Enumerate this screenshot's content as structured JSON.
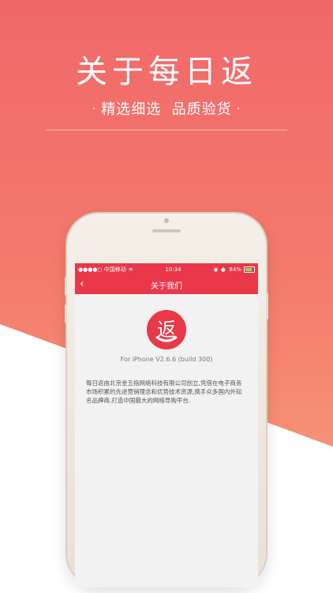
{
  "hero": {
    "title": "关于每日返",
    "subtitle_left": "精选细选",
    "subtitle_right": "品质验货",
    "dot": "·"
  },
  "status_bar": {
    "carrier": "●●●●○ 中国移动",
    "wifi": "≋",
    "time": "10:34",
    "icons": "◉ ⏰",
    "battery": "84%"
  },
  "nav": {
    "back_icon": "‹",
    "title": "关于我们"
  },
  "about": {
    "logo_char": "返",
    "version": "For iPhone V2.6.6 (build 300)",
    "description": "每日返由北京金五指网络科技有限公司创立,凭借在电子商务市场积累的先进营销理念和优势技术资源,携手众多国内外知名品牌商,打造中国最大的网络导购平台."
  },
  "colors": {
    "accent": "#e8384a",
    "background_top": "#f0686a",
    "background_bottom": "#f8a47f"
  }
}
